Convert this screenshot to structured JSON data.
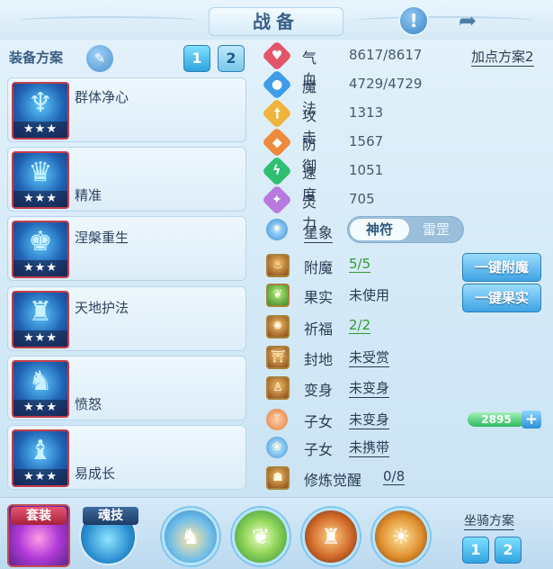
{
  "header": {
    "title": "战备"
  },
  "equip_scheme": {
    "label": "装备方案",
    "buttons": [
      "1",
      "2"
    ],
    "active": "1"
  },
  "equips": [
    {
      "name": "群体净心",
      "stars": "★★★"
    },
    {
      "name": "精准",
      "stars": "★★★"
    },
    {
      "name": "涅槃重生",
      "stars": "★★★"
    },
    {
      "name": "天地护法",
      "stars": "★★★"
    },
    {
      "name": "愤怒",
      "stars": "★★★"
    },
    {
      "name": "易成长",
      "stars": "★★★"
    }
  ],
  "attributes": [
    {
      "name": "气血",
      "value": "8617/8617",
      "icon": "heart-icon",
      "color": "#e2556a"
    },
    {
      "name": "魔法",
      "value": "4729/4729",
      "icon": "mana-icon",
      "color": "#3f9de8"
    },
    {
      "name": "攻击",
      "value": "1313",
      "icon": "sword-icon",
      "color": "#f0b43a"
    },
    {
      "name": "防御",
      "value": "1567",
      "icon": "shield-icon",
      "color": "#f08a3a"
    },
    {
      "name": "速度",
      "value": "1051",
      "icon": "lightning-icon",
      "color": "#2fbf71"
    },
    {
      "name": "灵力",
      "value": "705",
      "icon": "spirit-icon",
      "color": "#b779e0"
    }
  ],
  "plan_link": "加点方案2",
  "xingxiang": {
    "label": "星象",
    "toggle_on": "神符",
    "toggle_off": "雷罡"
  },
  "rows": {
    "fumo": {
      "name": "附魔",
      "value": "5/5"
    },
    "guoshi": {
      "name": "果实",
      "value": "未使用"
    },
    "qifu": {
      "name": "祈福",
      "value": "2/2"
    },
    "fengdi": {
      "name": "封地",
      "value": "未受赏"
    },
    "bianshen": {
      "name": "变身",
      "value": "未变身"
    },
    "zinv1": {
      "name": "子女",
      "value": "未变身"
    },
    "zinv2": {
      "name": "子女",
      "value": "未携带"
    },
    "xiulian": {
      "name": "修炼觉醒",
      "value": "0/8"
    }
  },
  "actions": {
    "fumo": "一键附魔",
    "guoshi": "一键果实"
  },
  "currency": {
    "amount": "2895",
    "plus": "+"
  },
  "bottom": {
    "taozhuang": "套装",
    "hunji": "魂技",
    "mount_label": "坐骑方案",
    "mount_buttons": [
      "1",
      "2"
    ],
    "mount_active": "1"
  }
}
